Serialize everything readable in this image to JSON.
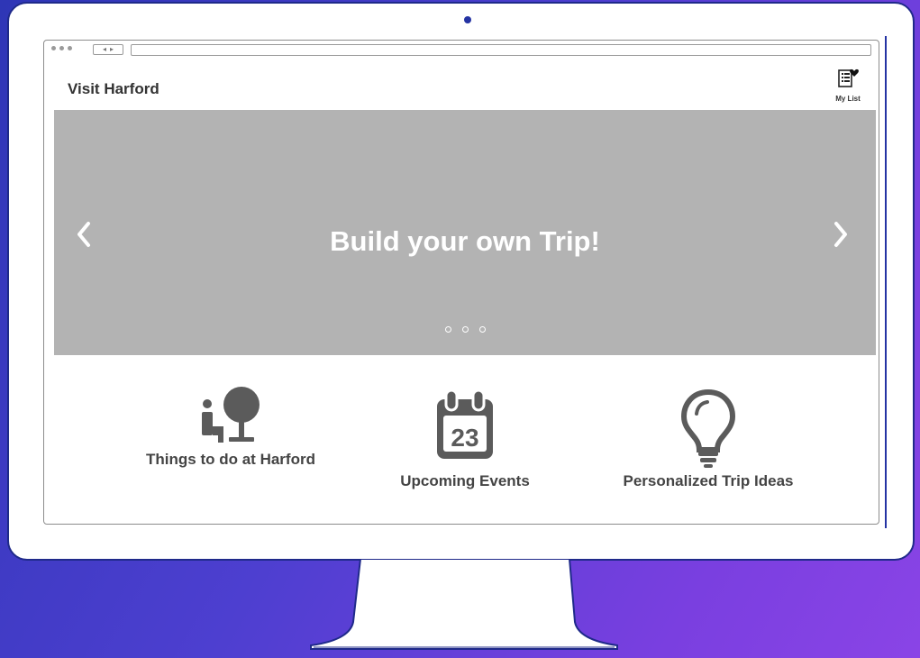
{
  "site": {
    "title": "Visit Harford",
    "my_list_label": "My List"
  },
  "hero": {
    "title": "Build your own Trip!",
    "slides": 3
  },
  "features": [
    {
      "label": "Things to do at Harford",
      "icon": "park-icon"
    },
    {
      "label": "Upcoming Events",
      "icon": "calendar-icon",
      "calendar_day": "23"
    },
    {
      "label": "Personalized Trip Ideas",
      "icon": "lightbulb-icon"
    }
  ],
  "colors": {
    "background_start": "#2e36b6",
    "background_end": "#8a44e6",
    "hero": "#b3b3b3",
    "icon": "#5b5b5b"
  }
}
